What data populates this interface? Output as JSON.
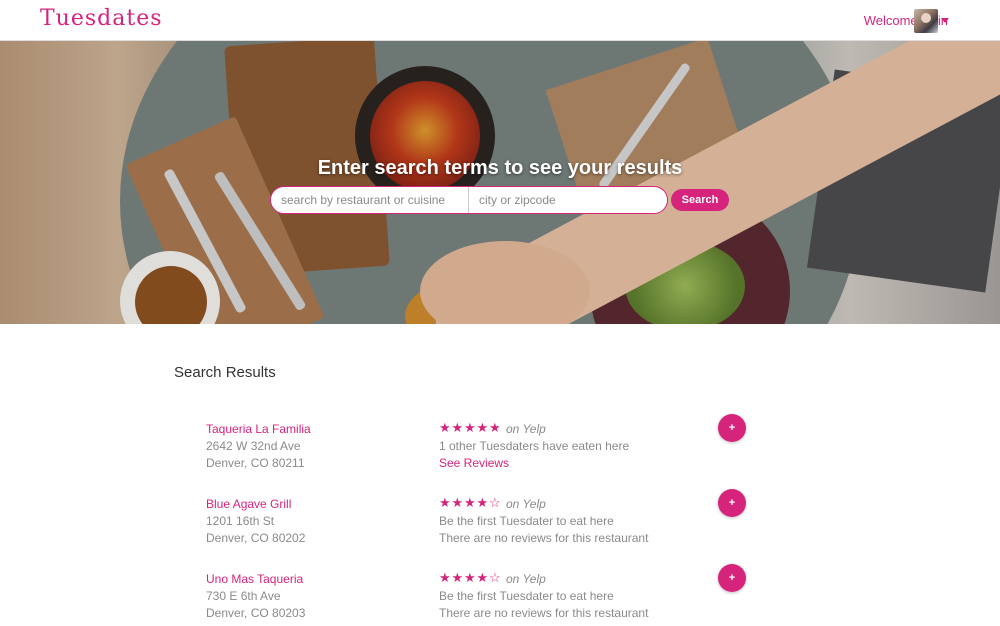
{
  "nav": {
    "brand": "Tuesdates",
    "welcome": "Welcome, Erin"
  },
  "hero": {
    "title": "Enter search terms to see your results",
    "term_placeholder": "search by restaurant or cuisine",
    "city_placeholder": "city or zipcode",
    "search_label": "Search"
  },
  "results": {
    "title": "Search Results",
    "items": [
      {
        "name": "Taqueria La Familia",
        "address": "2642 W 32nd Ave",
        "city": "Denver, CO 80211",
        "rating": 5,
        "rating_source": "on Yelp",
        "line1": "1 other Tuesdaters have eaten here",
        "line2": "See Reviews",
        "add_label": "+"
      },
      {
        "name": "Blue Agave Grill",
        "address": "1201 16th St",
        "city": "Denver, CO 80202",
        "rating": 4,
        "rating_source": "on Yelp",
        "line1": "Be the first Tuesdater to eat here",
        "line2": "There are no reviews for this restaurant",
        "add_label": "+"
      },
      {
        "name": "Uno Mas Taqueria",
        "address": "730 E 6th Ave",
        "city": "Denver, CO 80203",
        "rating": 4,
        "rating_source": "on Yelp",
        "line1": "Be the first Tuesdater to eat here",
        "line2": "There are no reviews for this restaurant",
        "add_label": "+"
      }
    ]
  },
  "colors": {
    "accent": "#d6247c",
    "muted_text": "#8a8a8a"
  },
  "icons": {
    "star_full": "★",
    "star_empty": "☆",
    "dropdown": "caret-down-icon"
  }
}
